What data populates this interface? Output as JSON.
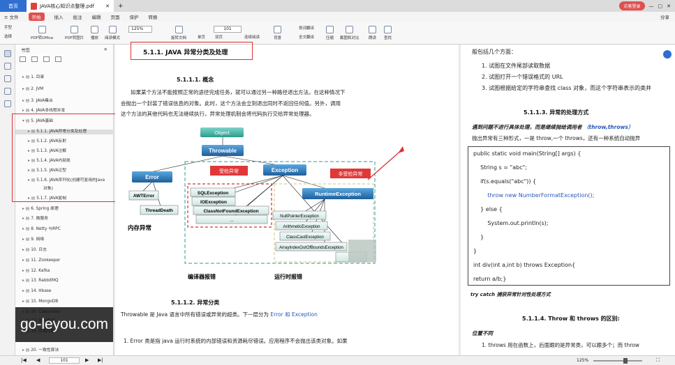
{
  "titlebar": {
    "home": "首页",
    "doc_tab": "JAVA核心知识点整理.pdf",
    "add": "+",
    "login": "访客登录",
    "share": "分享"
  },
  "menu": [
    "开始",
    "插入",
    "批注",
    "编辑",
    "页面",
    "保护",
    "转换"
  ],
  "toolbar": {
    "hand": "手型",
    "select": "选择",
    "pdf_office": "PDF转Office",
    "pdf_image": "PDF转图片",
    "play": "播放",
    "read": "阅读模式",
    "zoom": "125%",
    "rotate": "旋转文档",
    "single": "单页",
    "double": "双页",
    "continuous": "连续阅读",
    "page": "101",
    "background": "背景",
    "translate_sel": "划词翻译",
    "translate_full": "全文翻译",
    "compress": "压缩",
    "screenshot": "截图和对比",
    "read_aloud": "朗读",
    "find": "查找"
  },
  "sidebar": {
    "title": "书签",
    "items": [
      {
        "label": "1. 目录",
        "level": 1
      },
      {
        "label": "2. JVM",
        "level": 1
      },
      {
        "label": "3. JAVA集合",
        "level": 1
      },
      {
        "label": "4. JAVA多线程并发",
        "level": 1
      },
      {
        "label": "5. JAVA基础",
        "level": 1
      },
      {
        "label": "5.1.1. JAVA异常分类及处理",
        "level": 2
      },
      {
        "label": "5.1.2. JAVA反射",
        "level": 2
      },
      {
        "label": "5.1.3. JAVA注解",
        "level": 2
      },
      {
        "label": "5.1.4. JAVA内部类",
        "level": 2
      },
      {
        "label": "5.1.5. JAVA泛型",
        "level": 2
      },
      {
        "label": "5.1.6. JAVA序列化(创建可复用的Java",
        "level": 2
      },
      {
        "label": "对象)",
        "level": 3
      },
      {
        "label": "5.1.7. JAVA复制",
        "level": 2
      },
      {
        "label": "6. Spring 原理",
        "level": 1
      },
      {
        "label": "7.  微服务",
        "level": 1
      },
      {
        "label": "8. Netty 与RPC",
        "level": 1
      },
      {
        "label": "9. 网络",
        "level": 1
      },
      {
        "label": "10. 日志",
        "level": 1
      },
      {
        "label": "11. Zookeeper",
        "level": 1
      },
      {
        "label": "12. Kafka",
        "level": 1
      },
      {
        "label": "13. RabbitMQ",
        "level": 1
      },
      {
        "label": "14. Hbase",
        "level": 1
      },
      {
        "label": "15. MongoDB",
        "level": 1
      },
      {
        "label": "16. Cassandra",
        "level": 1
      },
      {
        "label": "17. 设计模式",
        "level": 1
      },
      {
        "label": "18. 负载均衡",
        "level": 1
      },
      {
        "label": "20. 一致性算法",
        "level": 1
      }
    ]
  },
  "watermark": "go-leyou.com",
  "left_page": {
    "heading": "5.1.1.  JAVA 异常分类及处理",
    "sub1": "5.1.1.1.      概念",
    "para1_l1": "如果某个方法不能按照正常的途径完成任务，就可以通过另一种路径退出方法。在这种情况下",
    "para1_l2": "会抛出一个封装了错误信息的对象。此时，这个方法会立刻退出同时不返回任何值。另外，调用",
    "para1_l3": "这个方法的其他代码也无法继续执行，异常处理机制会将代码执行交给异常处理器。",
    "diagram": {
      "object": "Object",
      "throwable": "Throwable",
      "error": "Error",
      "exception": "Exception",
      "checked": "受检异常",
      "unchecked": "非受检异常",
      "awt": "AWTError",
      "thread": "ThreadDeath",
      "sql": "SQLException",
      "io": "IOException",
      "cnf": "ClassNotFoundException",
      "dots": "...",
      "runtime": "RuntimeException",
      "npe": "NullPointerException",
      "arith": "ArithmeticException",
      "cce": "ClassCastException",
      "aio": "ArrayIndexOutOfBoundsException",
      "mem": "内存异常",
      "compile": "编译器报错",
      "run": "运行时报错"
    },
    "sub2": "5.1.1.2.      异常分类",
    "para2": "Throwable 是 Java 语言中所有错误或异常的超类。下一层分为 ",
    "para2_link": "Error 和 Exception",
    "para3": "1.    Error 类是指 java 运行时系统的内部错误和资源耗尽错误。应用程序不会抛出该类对象。如果"
  },
  "right_page": {
    "line0": "般包括几个方面：",
    "li1": "1.    试图在文件尾部读取数据",
    "li2": "2.    试图打开一个错误格式的 URL",
    "li3": "3.    试图根据给定的字符串查找 class 对象，而这个字符串表示的类并",
    "sub3": "5.1.1.3.      异常的处理方式",
    "bold_italic": "遇到问题不进行具体处理，而是继续抛给调用者 ",
    "bold_italic_link": "（throw,throws）",
    "line_throw": "抛出异常有三种形式，一是 throw,一个 throws，还有一种系统自动抛异",
    "code": [
      "public static void main(String[] args) {",
      "    String s = \"abc\";",
      "    if(s.equals(\"abc\")) {",
      "        throw new NumberFormatException();",
      "    } else {",
      "        System.out.println(s);",
      "    }",
      "}",
      "int div(int a,int b) throws Exception{",
      "return a/b;}"
    ],
    "try_catch": "try catch 捕获异常针对性处理方式",
    "sub4": "5.1.1.4.      Throw 和 throws 的区别:",
    "pos_diff": "位置不同",
    "li_last": "1.    throws 用在函数上，后面跟的是异常类，可以跟多个；而 throw"
  },
  "status": {
    "page": "101",
    "zoom": "125%"
  }
}
